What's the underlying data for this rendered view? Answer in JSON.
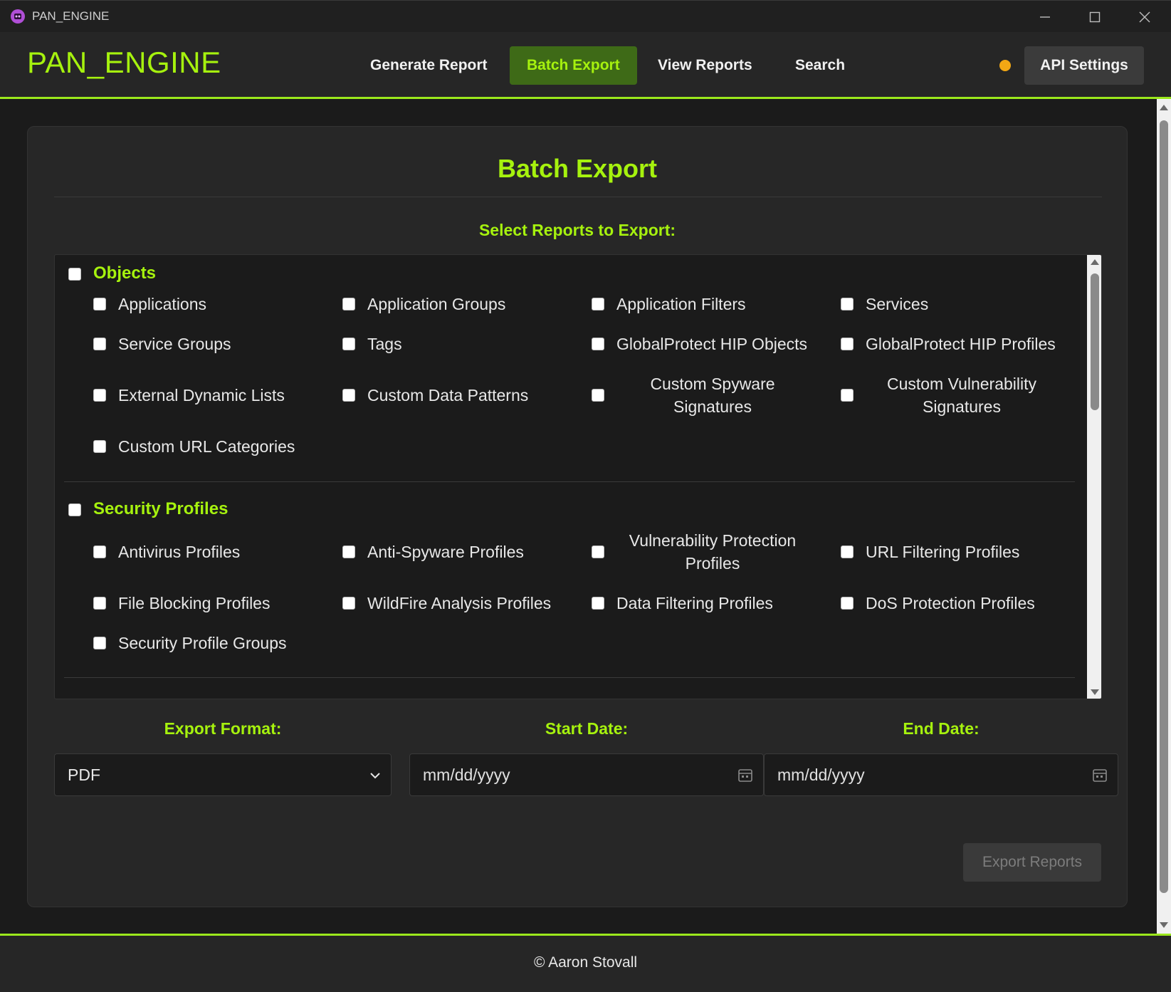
{
  "window": {
    "title": "PAN_ENGINE",
    "controls": [
      "minimize-icon",
      "maximize-icon",
      "close-icon"
    ]
  },
  "header": {
    "brand": "PAN_ENGINE",
    "nav": [
      {
        "label": "Generate Report"
      },
      {
        "label": "Batch Export",
        "active": true
      },
      {
        "label": "View Reports"
      },
      {
        "label": "Search"
      }
    ],
    "status_color": "#f2a714",
    "api_settings": "API Settings"
  },
  "main": {
    "title": "Batch Export",
    "select_label": "Select Reports to Export:",
    "groups": [
      {
        "label": "Objects",
        "items": [
          "Applications",
          "Application Groups",
          "Application Filters",
          "Services",
          "Service Groups",
          "Tags",
          "GlobalProtect HIP Objects",
          "GlobalProtect HIP Profiles",
          "External Dynamic Lists",
          "Custom Data Patterns",
          "Custom Spyware Signatures",
          "Custom Vulnerability Signatures",
          "Custom URL Categories"
        ]
      },
      {
        "label": "Security Profiles",
        "items": [
          "Antivirus Profiles",
          "Anti-Spyware Profiles",
          "Vulnerability Protection Profiles",
          "URL Filtering Profiles",
          "File Blocking Profiles",
          "WildFire Analysis Profiles",
          "Data Filtering Profiles",
          "DoS Protection Profiles",
          "Security Profile Groups"
        ]
      }
    ],
    "export_format": {
      "label": "Export Format:",
      "value": "PDF"
    },
    "start_date": {
      "label": "Start Date:",
      "placeholder": "mm/dd/yyyy"
    },
    "end_date": {
      "label": "End Date:",
      "placeholder": "mm/dd/yyyy"
    },
    "export_button": "Export Reports"
  },
  "footer": {
    "text": "© Aaron Stovall"
  },
  "colors": {
    "accent": "#a6f20e",
    "active_nav_bg": "#3e6a17",
    "background": "#1b1b1b"
  }
}
